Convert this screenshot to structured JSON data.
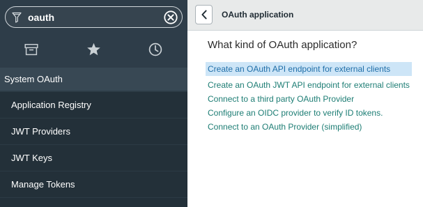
{
  "nav": {
    "filter": {
      "value": "oauth"
    },
    "tabs": [
      {
        "id": "all",
        "icon": "archive-icon"
      },
      {
        "id": "favorites",
        "icon": "star-icon"
      },
      {
        "id": "history",
        "icon": "clock-icon"
      }
    ],
    "section": {
      "label": "System OAuth"
    },
    "modules": [
      {
        "label": "Application Registry"
      },
      {
        "label": "JWT Providers"
      },
      {
        "label": "JWT Keys"
      },
      {
        "label": "Manage Tokens"
      }
    ]
  },
  "header": {
    "back_icon": "chevron-left-icon",
    "title": "OAuth application"
  },
  "main": {
    "question": "What kind of OAuth application?",
    "options": [
      {
        "label": "Create an OAuth API endpoint for external clients",
        "selected": true
      },
      {
        "label": "Create an OAuth JWT API endpoint for external clients",
        "selected": false
      },
      {
        "label": "Connect to a third party OAuth Provider",
        "selected": false
      },
      {
        "label": "Configure an OIDC provider to verify ID tokens.",
        "selected": false
      },
      {
        "label": "Connect to an OAuth Provider (simplified)",
        "selected": false
      }
    ]
  },
  "colors": {
    "nav_bg": "#2e3d49",
    "module_bg": "#233039",
    "link": "#1d7d74",
    "selected_bg": "#cde5f7",
    "header_bg": "#e8eaea"
  }
}
